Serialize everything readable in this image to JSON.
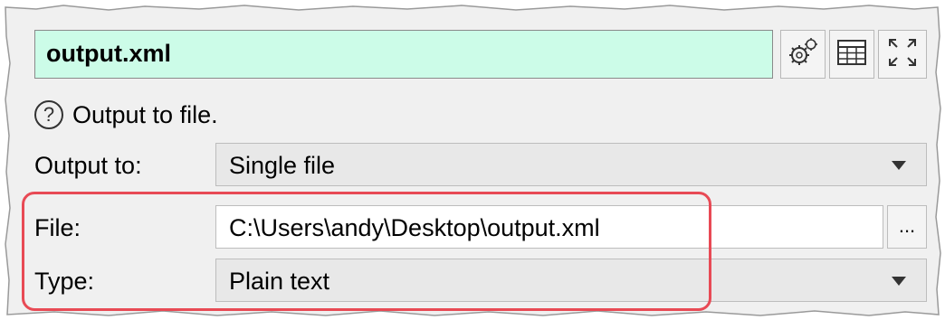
{
  "header": {
    "filename": "output.xml",
    "icons": [
      "gears-icon",
      "table-icon",
      "expand-icon"
    ]
  },
  "help": {
    "icon": "question-circle-icon",
    "text": "Output to file."
  },
  "form": {
    "output_to": {
      "label": "Output to:",
      "value": "Single file"
    },
    "file": {
      "label": "File:",
      "value": "C:\\Users\\andy\\Desktop\\output.xml",
      "browse_label": "..."
    },
    "type": {
      "label": "Type:",
      "value": "Plain text"
    }
  },
  "colors": {
    "title_field_bg": "#ccfce8",
    "highlight_border": "#e84a55",
    "panel_bg": "#f0f0f0"
  }
}
